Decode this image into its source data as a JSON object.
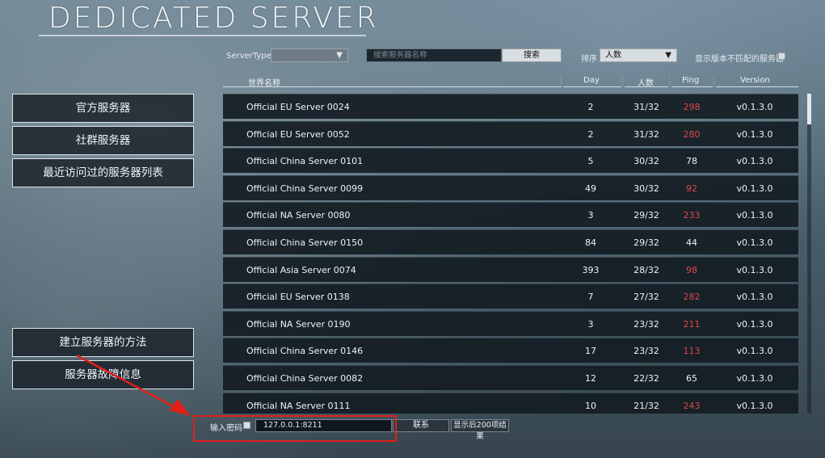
{
  "header": {
    "title": "DEDICATED SERVER"
  },
  "filters": {
    "server_type_label": "ServerType",
    "server_type_value": "",
    "search_placeholder": "搜索服务器名称",
    "search_button": "搜索",
    "sort_label": "排序",
    "sort_value": "人数",
    "show_mismatch_label": "显示版本不匹配的服务器"
  },
  "columns": {
    "name": "世界名称",
    "day": "Day",
    "players": "人数",
    "ping": "Ping",
    "version": "Version"
  },
  "menu": {
    "official": "官方服务器",
    "community": "社群服务器",
    "recent": "最近访问过的服务器列表",
    "how_to": "建立服务器的方法",
    "troubleshoot": "服务器故障信息"
  },
  "servers": [
    {
      "name": "Official EU Server 0024",
      "day": "2",
      "players": "31/32",
      "ping": "298",
      "version": "v0.1.3.0",
      "ping_color": "#e0464b"
    },
    {
      "name": "Official EU Server 0052",
      "day": "2",
      "players": "31/32",
      "ping": "280",
      "version": "v0.1.3.0",
      "ping_color": "#e0464b"
    },
    {
      "name": "Official China Server 0101",
      "day": "5",
      "players": "30/32",
      "ping": "78",
      "version": "v0.1.3.0",
      "ping_color": "#eef2f4"
    },
    {
      "name": "Official China Server 0099",
      "day": "49",
      "players": "30/32",
      "ping": "92",
      "version": "v0.1.3.0",
      "ping_color": "#e0464b"
    },
    {
      "name": "Official NA Server 0080",
      "day": "3",
      "players": "29/32",
      "ping": "233",
      "version": "v0.1.3.0",
      "ping_color": "#e0464b"
    },
    {
      "name": "Official China Server 0150",
      "day": "84",
      "players": "29/32",
      "ping": "44",
      "version": "v0.1.3.0",
      "ping_color": "#eef2f4"
    },
    {
      "name": "Official Asia Server 0074",
      "day": "393",
      "players": "28/32",
      "ping": "98",
      "version": "v0.1.3.0",
      "ping_color": "#e0464b"
    },
    {
      "name": "Official EU Server 0138",
      "day": "7",
      "players": "27/32",
      "ping": "282",
      "version": "v0.1.3.0",
      "ping_color": "#e0464b"
    },
    {
      "name": "Official NA Server 0190",
      "day": "3",
      "players": "23/32",
      "ping": "211",
      "version": "v0.1.3.0",
      "ping_color": "#e0464b"
    },
    {
      "name": "Official China Server 0146",
      "day": "17",
      "players": "23/32",
      "ping": "113",
      "version": "v0.1.3.0",
      "ping_color": "#e0464b"
    },
    {
      "name": "Official China Server 0082",
      "day": "12",
      "players": "22/32",
      "ping": "65",
      "version": "v0.1.3.0",
      "ping_color": "#eef2f4"
    },
    {
      "name": "Official NA Server 0111",
      "day": "10",
      "players": "21/32",
      "ping": "243",
      "version": "v0.1.3.0",
      "ping_color": "#e0464b"
    }
  ],
  "bottom": {
    "password_label": "输入密码",
    "address_value": "127.0.0.1:8211",
    "connect_button": "联系",
    "show_more_button": "显示后200项结果"
  },
  "annotation": {
    "color": "#e0201b"
  }
}
